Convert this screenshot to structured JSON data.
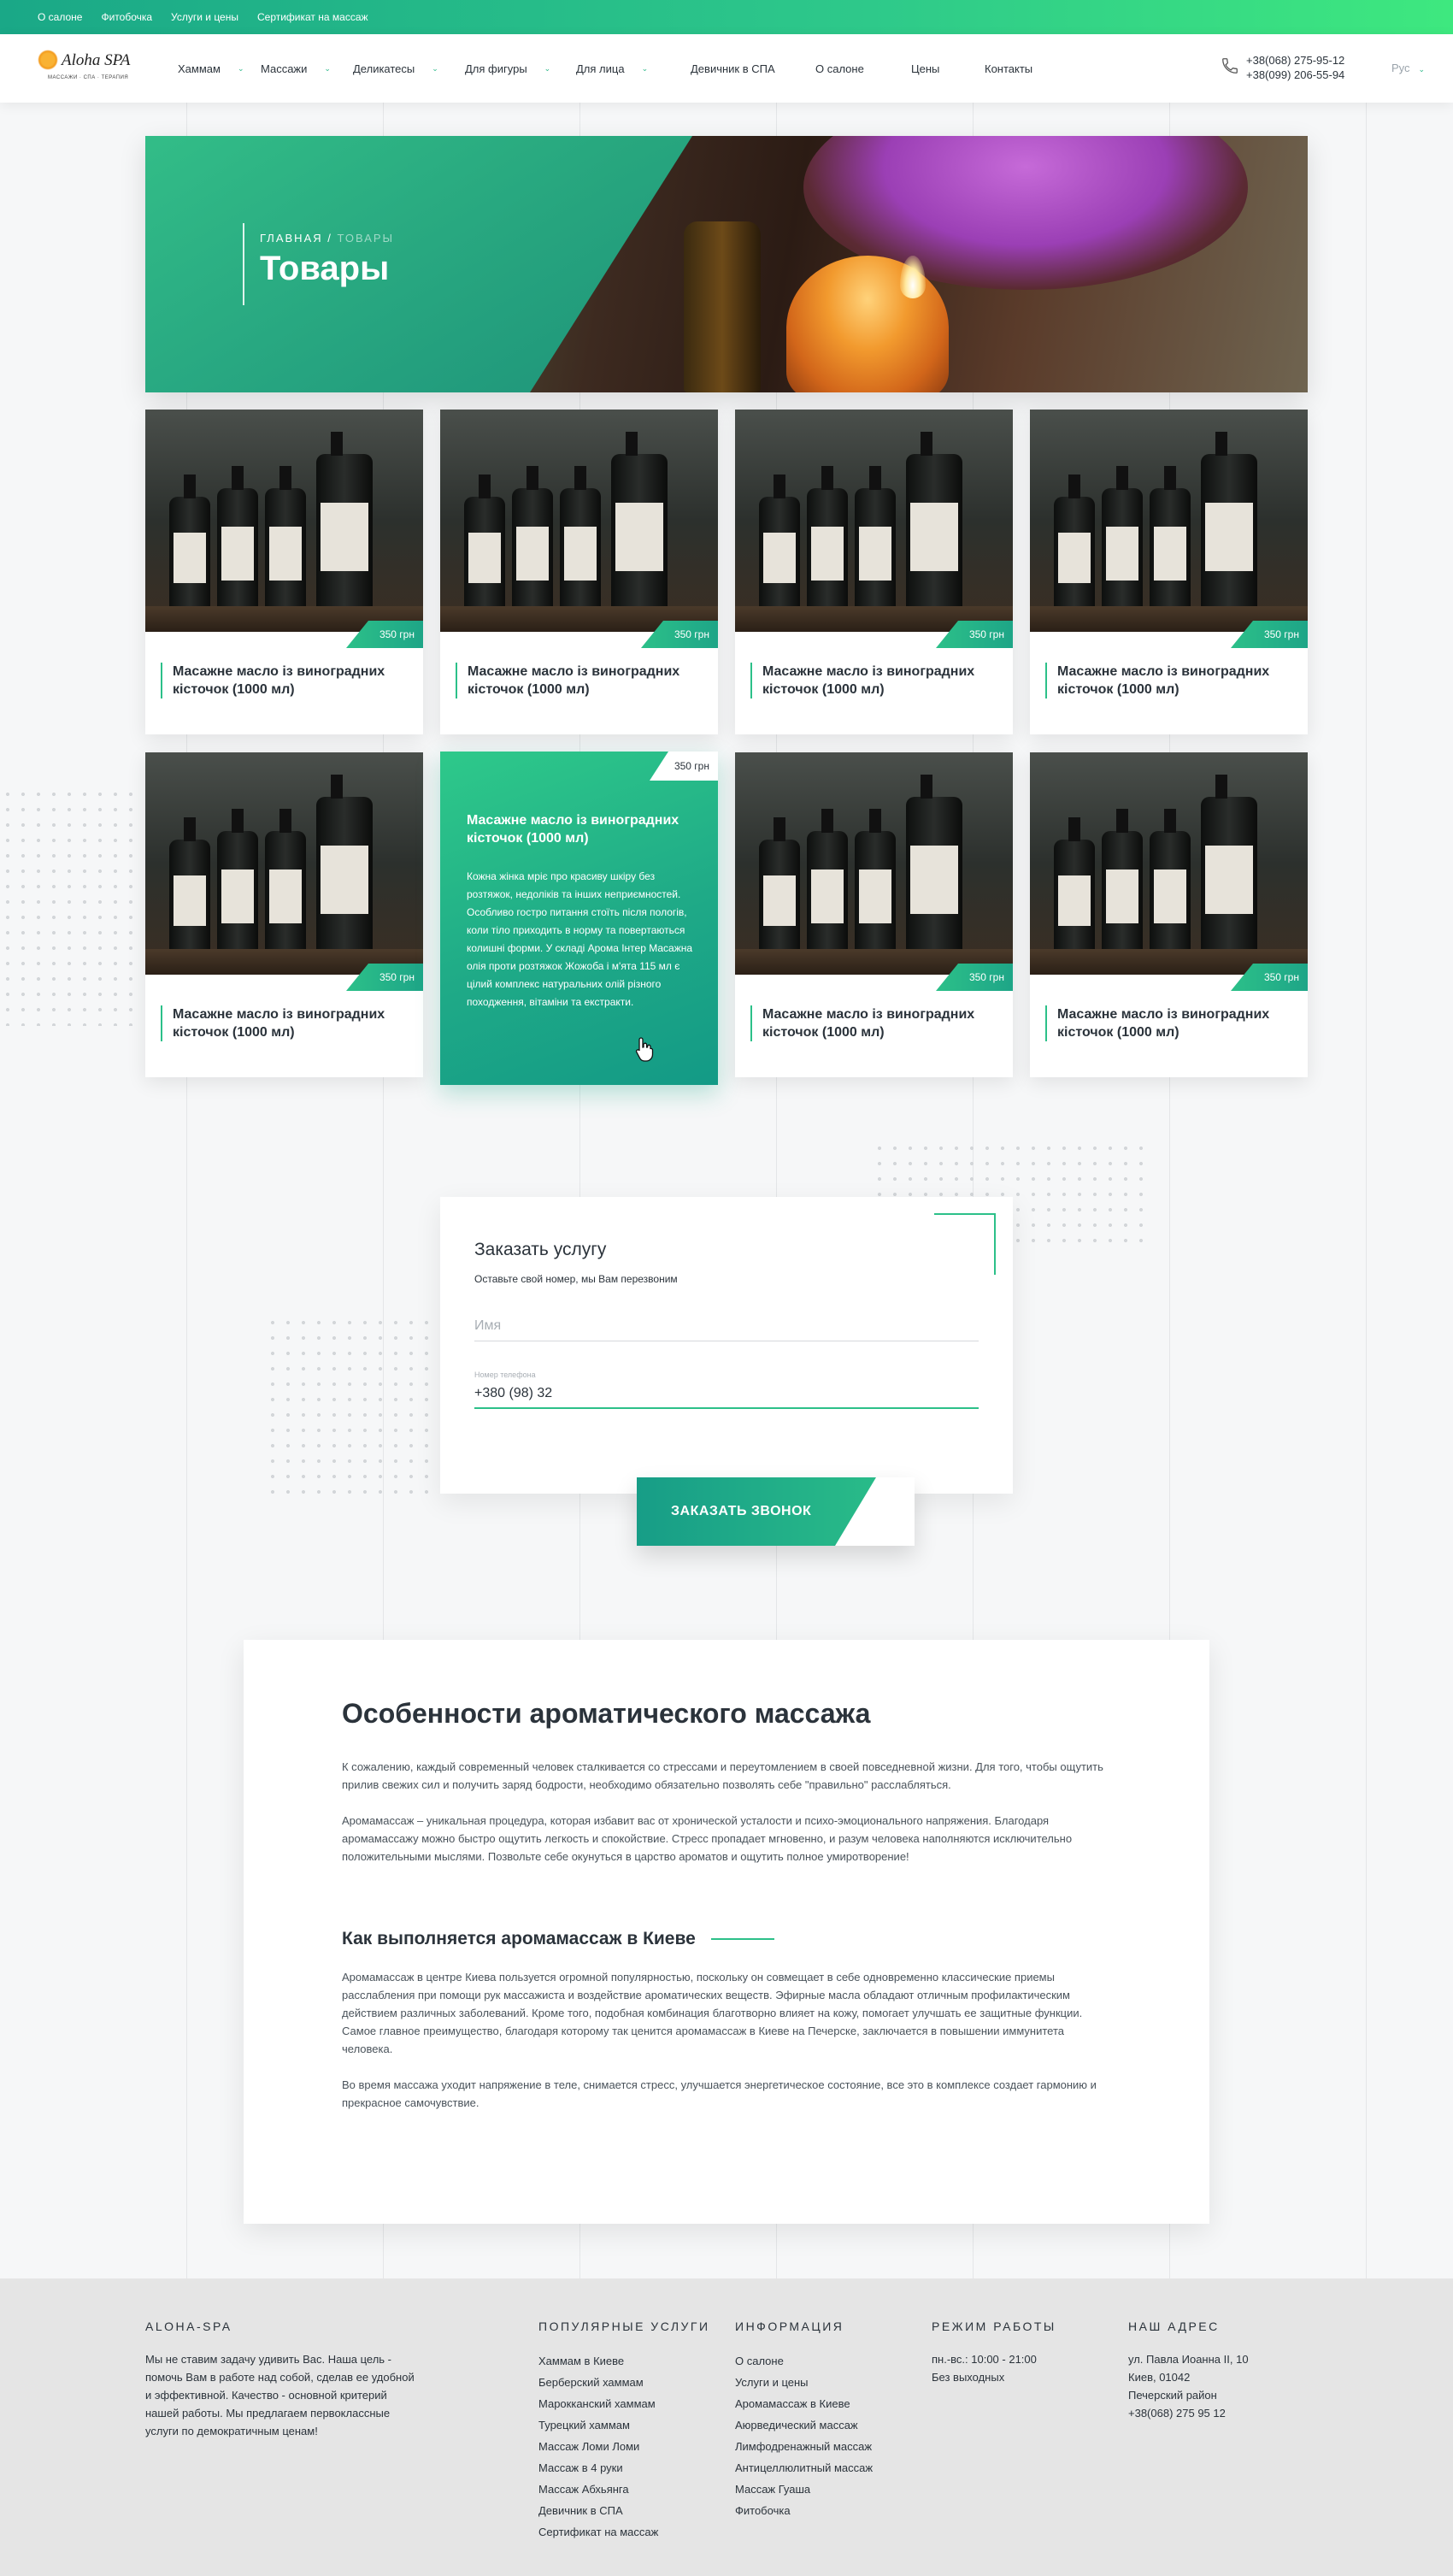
{
  "topbar": {
    "links": [
      "О салоне",
      "Фитобочка",
      "Услуги и цены",
      "Сертификат на массаж"
    ]
  },
  "logo": {
    "name": "Aloha SPA",
    "tagline": "МАССАЖИ · СПА · ТЕРАПИЯ"
  },
  "nav": {
    "items": [
      {
        "label": "Хаммам",
        "has_dropdown": true
      },
      {
        "label": "Массажи",
        "has_dropdown": true
      },
      {
        "label": "Деликатесы",
        "has_dropdown": true
      },
      {
        "label": "Для фигуры",
        "has_dropdown": true
      },
      {
        "label": "Для лица",
        "has_dropdown": true
      },
      {
        "label": "Девичник в СПА",
        "has_dropdown": false
      },
      {
        "label": "О салоне",
        "has_dropdown": false
      },
      {
        "label": "Цены",
        "has_dropdown": false
      },
      {
        "label": "Контакты",
        "has_dropdown": false
      }
    ],
    "phones": [
      "+38(068) 275-95-12",
      "+38(099) 206-55-94"
    ],
    "lang": "Рус"
  },
  "banner": {
    "crumb_home": "Главная",
    "crumb_sep": " / ",
    "crumb_current": "Товары",
    "title": "Товары"
  },
  "products": [
    {
      "price": "350 грн",
      "title": "Масажне масло із виноградних кісточок (1000 мл)"
    },
    {
      "price": "350 грн",
      "title": "Масажне масло із виноградних кісточок (1000 мл)"
    },
    {
      "price": "350 грн",
      "title": "Масажне масло із виноградних кісточок (1000 мл)"
    },
    {
      "price": "350 грн",
      "title": "Масажне масло із виноградних кісточок (1000 мл)"
    },
    {
      "price": "350 грн",
      "title": "Масажне масло із виноградних кісточок (1000 мл)"
    },
    {
      "price": "350 грн",
      "title": "Масажне масло із виноградних кісточок (1000 мл)",
      "description": "Кожна жінка мріє про красиву шкіру без розтяжок, недоліків та інших неприємностей. Особливо гостро питання стоїть після пологів, коли тіло приходить в норму та повертаються колишні форми. У складі Арома Інтер Масажна олія проти розтяжок Жожоба і м'ята 115 мл є цілий комплекс натуральних олій різного походження, вітаміни та екстракти."
    },
    {
      "price": "350 грн",
      "title": "Масажне масло із виноградних кісточок (1000 мл)"
    },
    {
      "price": "350 грн",
      "title": "Масажне масло із виноградних кісточок (1000 мл)"
    }
  ],
  "order_form": {
    "title": "Заказать услугу",
    "subtitle": "Оставьте свой номер, мы Вам перезвоним",
    "name_placeholder": "Имя",
    "phone_label": "Номер телефона",
    "phone_value": "+380 (98) 32",
    "button": "ЗАКАЗАТЬ ЗВОНОК"
  },
  "article": {
    "title": "Особенности ароматического массажа",
    "p1": "К сожалению, каждый современный человек сталкивается со стрессами и переутомлением в своей повседневной жизни. Для того, чтобы ощутить прилив свежих сил и получить заряд бодрости, необходимо обязательно позволять себе \"правильно\" расслабляться.",
    "p2": "Аромамассаж – уникальная процедура, которая  избавит вас от хронической усталости и психо-эмоционального напряжения. Благодаря аромамассажу можно быстро ощутить легкость и спокойствие. Стресс пропадает мгновенно, и разум человека наполняются исключительно положительными мыслями. Позвольте себе окунуться в царство ароматов  и ощутить полное умиротворение!",
    "subtitle": "Как выполняется аромамассаж в Киеве",
    "p3": "Аромамассаж в центре Киева пользуется огромной популярностью, поскольку он совмещает в себе одновременно классические приемы расслабления при помощи рук массажиста и воздействие ароматических веществ. Эфирные масла обладают отличным профилактическим действием различных заболеваний. Кроме того, подобная комбинация благотворно влияет на  кожу, помогает улучшать ее защитные функции. Самое главное преимущество, благодаря которому так ценится аромамассаж в Киеве на Печерске, заключается в повышении иммунитета человека.",
    "p4": "Во время массажа уходит напряжение в теле, снимается стресс, улучшается энергетическое состояние, все это в комплексе создает гармонию и прекрасное самочувствие."
  },
  "footer": {
    "about_title": "ALOHA-SPA",
    "about_text": "Мы не ставим задачу удивить Вас. Наша цель - помочь Вам в работе над собой, сделав ее удобной и эффективной. Качество - основной критерий нашей работы. Мы предлагаем первоклассные услуги по демократичным ценам!",
    "services_title": "ПОПУЛЯРНЫЕ УСЛУГИ",
    "services": [
      "Хаммам в Киеве",
      "Берберский хаммам",
      "Марокканский хаммам",
      "Турецкий хаммам",
      "Массаж Ломи Ломи",
      "Массаж в 4 руки",
      "Массаж Абхьянга",
      "Девичник в СПА",
      "Сертификат на массаж"
    ],
    "info_title": "ИНФОРМАЦИЯ",
    "info": [
      "О салоне",
      "Услуги и цены",
      "Аромамассаж в Киеве",
      "Аюрведический массаж",
      "Лимфодренажный массаж",
      "Антицеллюлитный массаж",
      "Массаж Гуаша",
      "Фитобочка"
    ],
    "hours_title": "РЕЖИМ РАБОТЫ",
    "hours": [
      "пн.-вс.: 10:00 - 21:00",
      "Без выходных"
    ],
    "address_title": "НАШ АДРЕС",
    "address": [
      "ул. Павла Иоанна II, 10",
      "Киев, 01042",
      "Печерский район",
      "+38(068) 275 95 12"
    ]
  },
  "colors": {
    "accent": "#2cc089",
    "accent_dark": "#179d87",
    "text": "#2b333b",
    "footer_bg": "#e5e5e5"
  }
}
